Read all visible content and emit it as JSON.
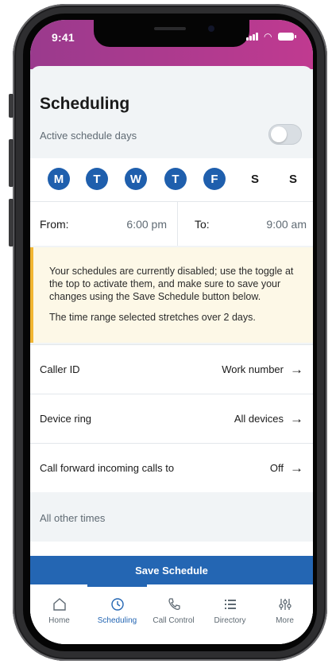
{
  "status": {
    "time": "9:41"
  },
  "header": {
    "title": "Scheduling"
  },
  "schedule": {
    "active_label": "Active schedule days",
    "active": false,
    "days": [
      {
        "label": "M",
        "selected": true
      },
      {
        "label": "T",
        "selected": true
      },
      {
        "label": "W",
        "selected": true
      },
      {
        "label": "T",
        "selected": true
      },
      {
        "label": "F",
        "selected": true
      },
      {
        "label": "S",
        "selected": false
      },
      {
        "label": "S",
        "selected": false
      }
    ],
    "from_label": "From:",
    "from_value": "6:00 pm",
    "to_label": "To:",
    "to_value": "9:00 am"
  },
  "notice": {
    "line1": "Your schedules are currently disabled; use the toggle at the top to activate them, and make sure to save your changes using the Save Schedule button below.",
    "line2": "The time range selected stretches over 2 days."
  },
  "settings": [
    {
      "label": "Caller ID",
      "value": "Work number"
    },
    {
      "label": "Device ring",
      "value": "All devices"
    },
    {
      "label": "Call forward incoming calls to",
      "value": "Off"
    }
  ],
  "other_times": {
    "label": "All other times"
  },
  "save": {
    "label": "Save Schedule"
  },
  "tabs": [
    {
      "label": "Home",
      "icon": "home-icon",
      "active": false
    },
    {
      "label": "Scheduling",
      "icon": "clock-icon",
      "active": true
    },
    {
      "label": "Call Control",
      "icon": "phone-icon",
      "active": false
    },
    {
      "label": "Directory",
      "icon": "list-icon",
      "active": false
    },
    {
      "label": "More",
      "icon": "sliders-icon",
      "active": false
    }
  ],
  "colors": {
    "brand_gradient_start": "#9a3a8d",
    "brand_gradient_end": "#c03a90",
    "primary": "#2466b3",
    "notice_bg": "#fdf8e7",
    "notice_border": "#f2b632"
  }
}
